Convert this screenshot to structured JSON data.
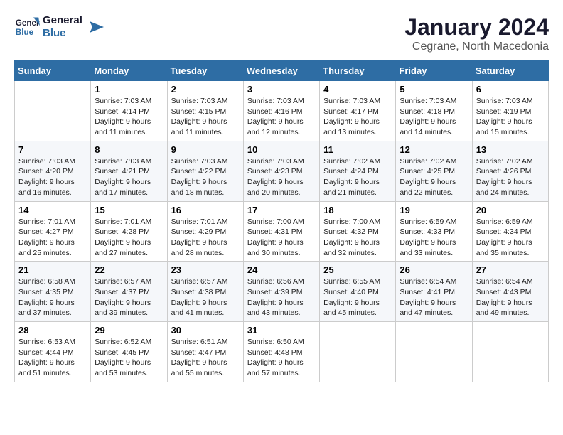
{
  "header": {
    "logo_general": "General",
    "logo_blue": "Blue",
    "month": "January 2024",
    "location": "Cegrane, North Macedonia"
  },
  "days_of_week": [
    "Sunday",
    "Monday",
    "Tuesday",
    "Wednesday",
    "Thursday",
    "Friday",
    "Saturday"
  ],
  "weeks": [
    [
      {
        "day": "",
        "info": ""
      },
      {
        "day": "1",
        "info": "Sunrise: 7:03 AM\nSunset: 4:14 PM\nDaylight: 9 hours\nand 11 minutes."
      },
      {
        "day": "2",
        "info": "Sunrise: 7:03 AM\nSunset: 4:15 PM\nDaylight: 9 hours\nand 11 minutes."
      },
      {
        "day": "3",
        "info": "Sunrise: 7:03 AM\nSunset: 4:16 PM\nDaylight: 9 hours\nand 12 minutes."
      },
      {
        "day": "4",
        "info": "Sunrise: 7:03 AM\nSunset: 4:17 PM\nDaylight: 9 hours\nand 13 minutes."
      },
      {
        "day": "5",
        "info": "Sunrise: 7:03 AM\nSunset: 4:18 PM\nDaylight: 9 hours\nand 14 minutes."
      },
      {
        "day": "6",
        "info": "Sunrise: 7:03 AM\nSunset: 4:19 PM\nDaylight: 9 hours\nand 15 minutes."
      }
    ],
    [
      {
        "day": "7",
        "info": "Sunrise: 7:03 AM\nSunset: 4:20 PM\nDaylight: 9 hours\nand 16 minutes."
      },
      {
        "day": "8",
        "info": "Sunrise: 7:03 AM\nSunset: 4:21 PM\nDaylight: 9 hours\nand 17 minutes."
      },
      {
        "day": "9",
        "info": "Sunrise: 7:03 AM\nSunset: 4:22 PM\nDaylight: 9 hours\nand 18 minutes."
      },
      {
        "day": "10",
        "info": "Sunrise: 7:03 AM\nSunset: 4:23 PM\nDaylight: 9 hours\nand 20 minutes."
      },
      {
        "day": "11",
        "info": "Sunrise: 7:02 AM\nSunset: 4:24 PM\nDaylight: 9 hours\nand 21 minutes."
      },
      {
        "day": "12",
        "info": "Sunrise: 7:02 AM\nSunset: 4:25 PM\nDaylight: 9 hours\nand 22 minutes."
      },
      {
        "day": "13",
        "info": "Sunrise: 7:02 AM\nSunset: 4:26 PM\nDaylight: 9 hours\nand 24 minutes."
      }
    ],
    [
      {
        "day": "14",
        "info": "Sunrise: 7:01 AM\nSunset: 4:27 PM\nDaylight: 9 hours\nand 25 minutes."
      },
      {
        "day": "15",
        "info": "Sunrise: 7:01 AM\nSunset: 4:28 PM\nDaylight: 9 hours\nand 27 minutes."
      },
      {
        "day": "16",
        "info": "Sunrise: 7:01 AM\nSunset: 4:29 PM\nDaylight: 9 hours\nand 28 minutes."
      },
      {
        "day": "17",
        "info": "Sunrise: 7:00 AM\nSunset: 4:31 PM\nDaylight: 9 hours\nand 30 minutes."
      },
      {
        "day": "18",
        "info": "Sunrise: 7:00 AM\nSunset: 4:32 PM\nDaylight: 9 hours\nand 32 minutes."
      },
      {
        "day": "19",
        "info": "Sunrise: 6:59 AM\nSunset: 4:33 PM\nDaylight: 9 hours\nand 33 minutes."
      },
      {
        "day": "20",
        "info": "Sunrise: 6:59 AM\nSunset: 4:34 PM\nDaylight: 9 hours\nand 35 minutes."
      }
    ],
    [
      {
        "day": "21",
        "info": "Sunrise: 6:58 AM\nSunset: 4:35 PM\nDaylight: 9 hours\nand 37 minutes."
      },
      {
        "day": "22",
        "info": "Sunrise: 6:57 AM\nSunset: 4:37 PM\nDaylight: 9 hours\nand 39 minutes."
      },
      {
        "day": "23",
        "info": "Sunrise: 6:57 AM\nSunset: 4:38 PM\nDaylight: 9 hours\nand 41 minutes."
      },
      {
        "day": "24",
        "info": "Sunrise: 6:56 AM\nSunset: 4:39 PM\nDaylight: 9 hours\nand 43 minutes."
      },
      {
        "day": "25",
        "info": "Sunrise: 6:55 AM\nSunset: 4:40 PM\nDaylight: 9 hours\nand 45 minutes."
      },
      {
        "day": "26",
        "info": "Sunrise: 6:54 AM\nSunset: 4:41 PM\nDaylight: 9 hours\nand 47 minutes."
      },
      {
        "day": "27",
        "info": "Sunrise: 6:54 AM\nSunset: 4:43 PM\nDaylight: 9 hours\nand 49 minutes."
      }
    ],
    [
      {
        "day": "28",
        "info": "Sunrise: 6:53 AM\nSunset: 4:44 PM\nDaylight: 9 hours\nand 51 minutes."
      },
      {
        "day": "29",
        "info": "Sunrise: 6:52 AM\nSunset: 4:45 PM\nDaylight: 9 hours\nand 53 minutes."
      },
      {
        "day": "30",
        "info": "Sunrise: 6:51 AM\nSunset: 4:47 PM\nDaylight: 9 hours\nand 55 minutes."
      },
      {
        "day": "31",
        "info": "Sunrise: 6:50 AM\nSunset: 4:48 PM\nDaylight: 9 hours\nand 57 minutes."
      },
      {
        "day": "",
        "info": ""
      },
      {
        "day": "",
        "info": ""
      },
      {
        "day": "",
        "info": ""
      }
    ]
  ]
}
